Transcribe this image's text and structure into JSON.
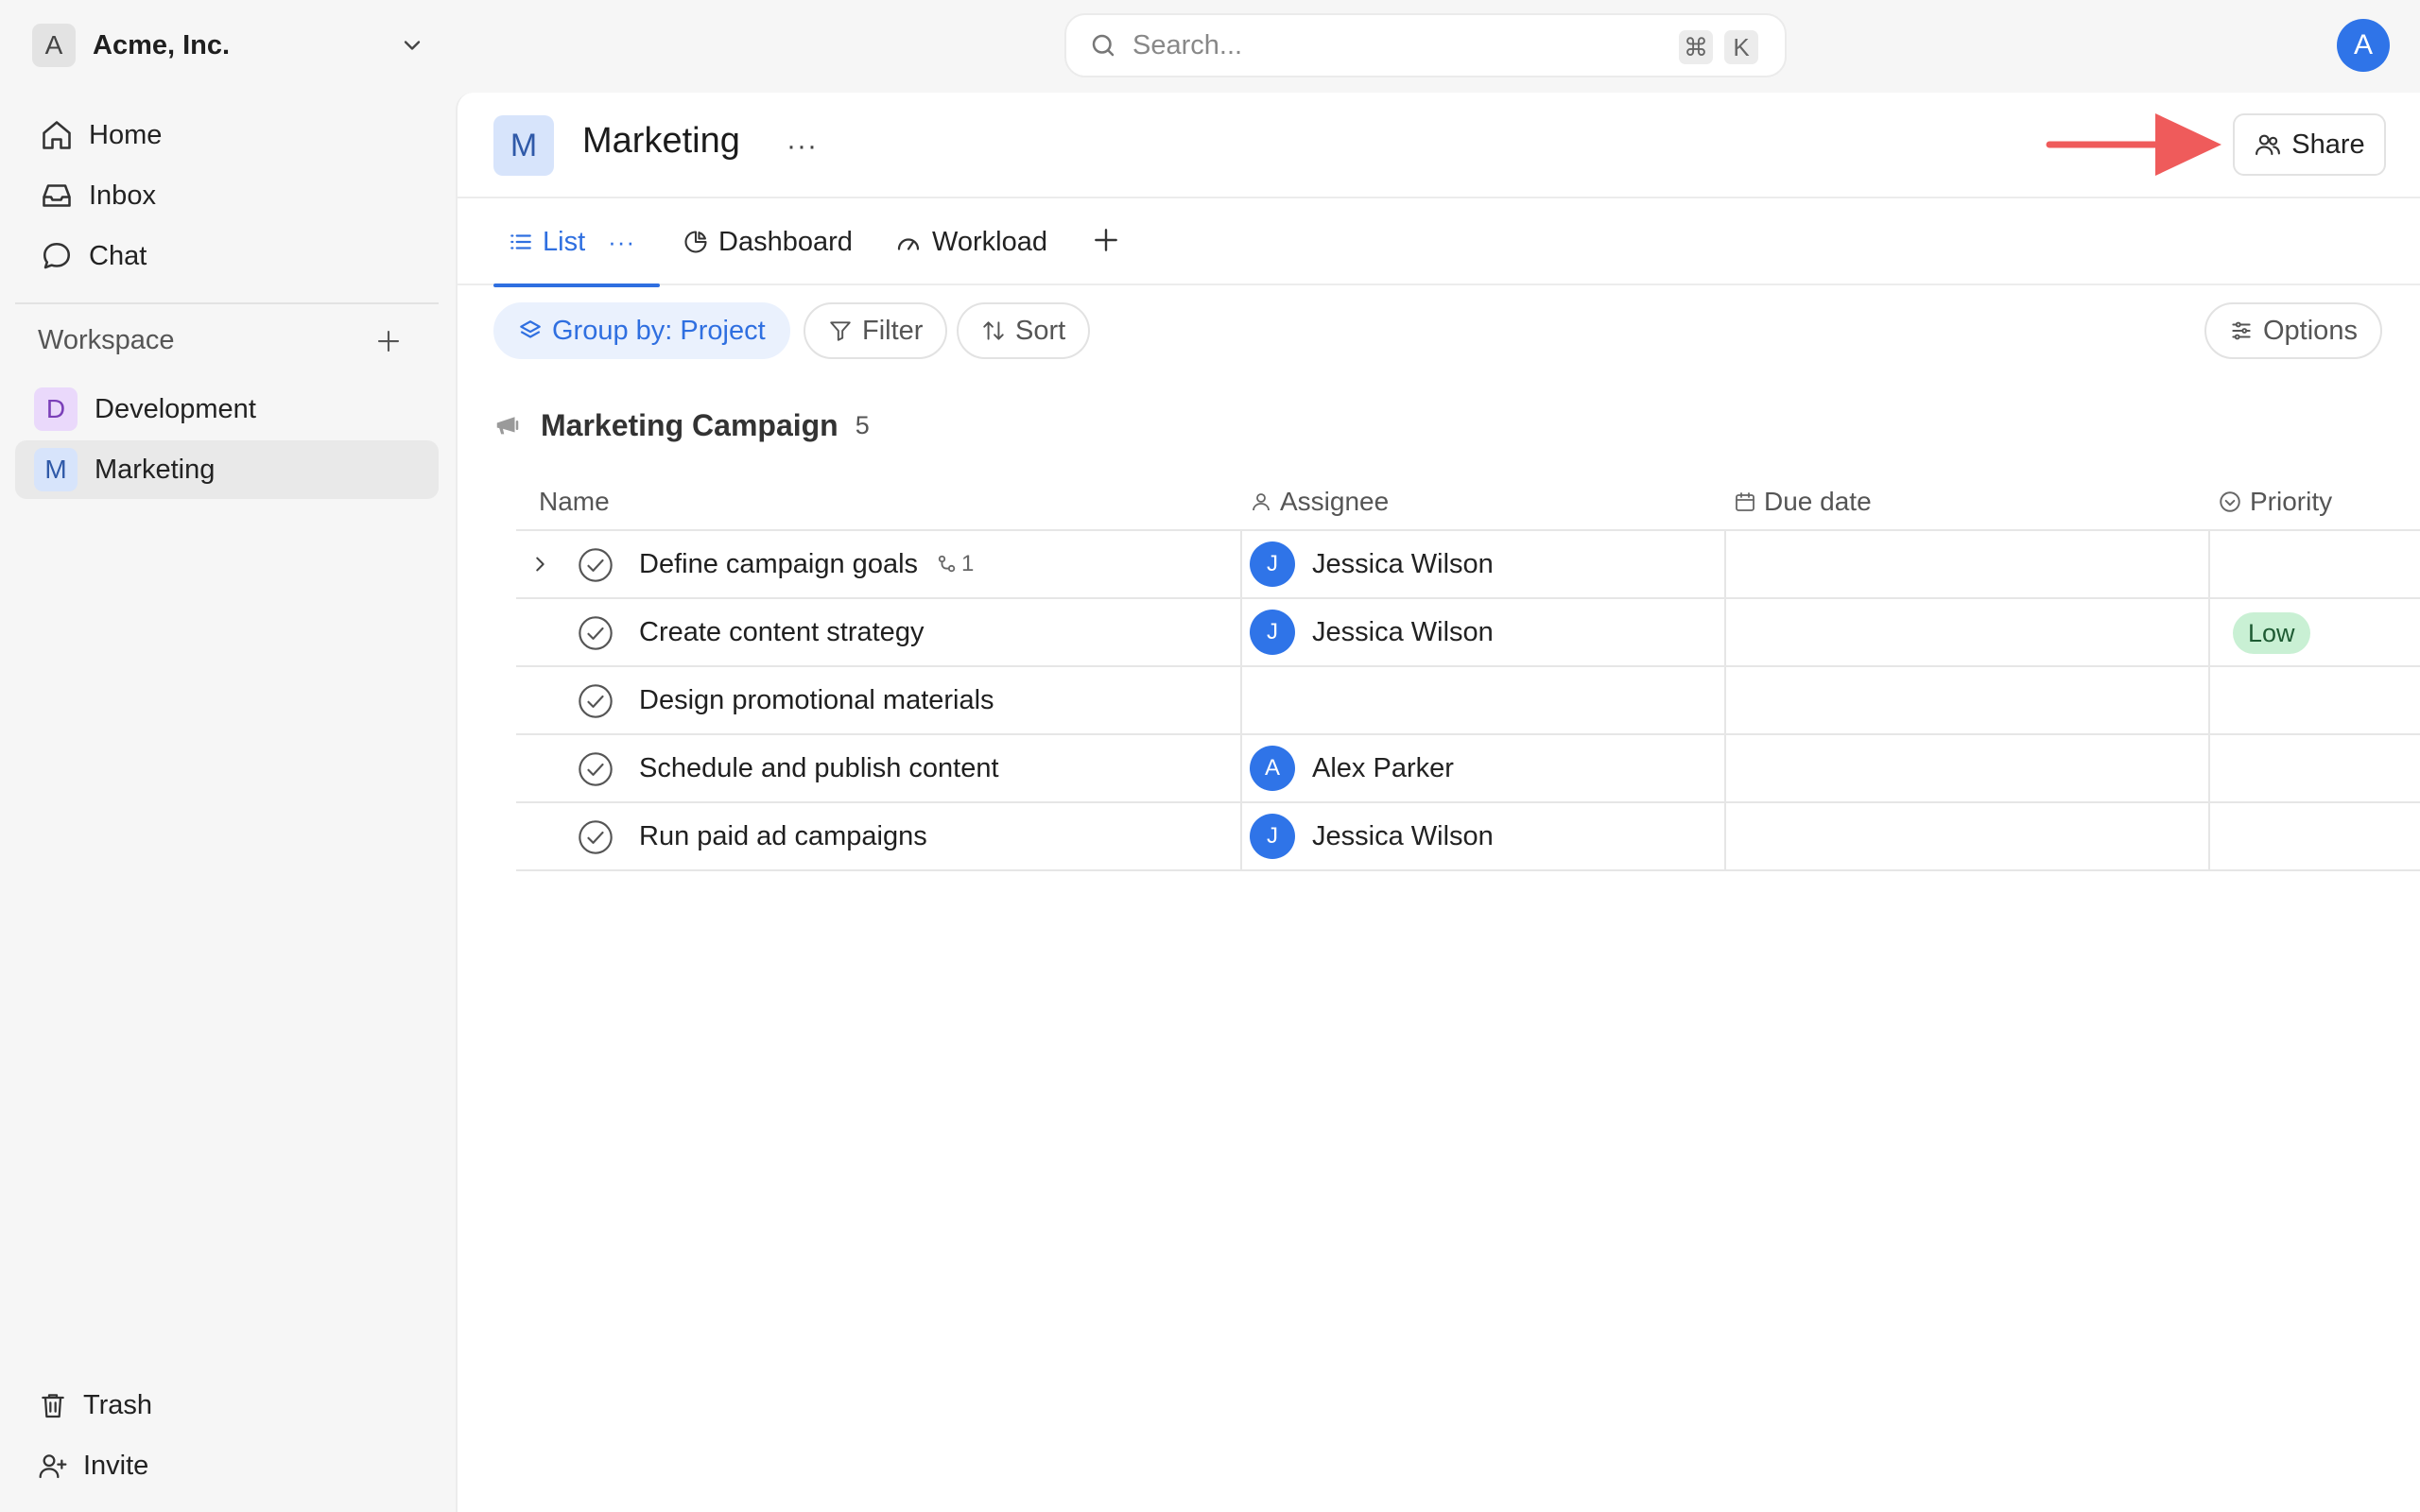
{
  "workspace_switcher": {
    "initial": "A",
    "name": "Acme, Inc."
  },
  "search": {
    "placeholder": "Search...",
    "shortcut_mod": "⌘",
    "shortcut_key": "K"
  },
  "user": {
    "initial": "A"
  },
  "sidebar": {
    "nav": [
      {
        "label": "Home",
        "icon": "home-icon"
      },
      {
        "label": "Inbox",
        "icon": "inbox-icon"
      },
      {
        "label": "Chat",
        "icon": "chat-icon"
      }
    ],
    "workspace_label": "Workspace",
    "projects": [
      {
        "initial": "D",
        "label": "Development",
        "color": "#ead9fb"
      },
      {
        "initial": "M",
        "label": "Marketing",
        "color": "#d7e4fb",
        "active": true
      }
    ],
    "bottom": [
      {
        "label": "Trash",
        "icon": "trash-icon"
      },
      {
        "label": "Invite",
        "icon": "invite-icon"
      }
    ]
  },
  "project": {
    "initial": "M",
    "title": "Marketing",
    "more": "···",
    "share_label": "Share"
  },
  "tabs": [
    {
      "label": "List",
      "active": true,
      "more": "···"
    },
    {
      "label": "Dashboard"
    },
    {
      "label": "Workload"
    }
  ],
  "toolbar": {
    "group_by": "Group by: Project",
    "filter": "Filter",
    "sort": "Sort",
    "options": "Options"
  },
  "group": {
    "title": "Marketing Campaign",
    "count": "5"
  },
  "table": {
    "columns": {
      "name": "Name",
      "assignee": "Assignee",
      "due_date": "Due date",
      "priority": "Priority"
    },
    "rows": [
      {
        "name": "Define campaign goals",
        "subtasks": "1",
        "assignee_initial": "J",
        "assignee": "Jessica Wilson",
        "due": "",
        "priority": ""
      },
      {
        "name": "Create content strategy",
        "assignee_initial": "J",
        "assignee": "Jessica Wilson",
        "due": "",
        "priority": "Low"
      },
      {
        "name": "Design promotional materials",
        "assignee_initial": "",
        "assignee": "",
        "due": "",
        "priority": ""
      },
      {
        "name": "Schedule and publish content",
        "assignee_initial": "A",
        "assignee": "Alex Parker",
        "due": "",
        "priority": ""
      },
      {
        "name": "Run paid ad campaigns",
        "assignee_initial": "J",
        "assignee": "Jessica Wilson",
        "due": "",
        "priority": ""
      }
    ]
  },
  "colors": {
    "accent": "#2f6fe0",
    "avatar_blue": "#2f74e8",
    "low_priority": "#c9f0d4",
    "annotation_arrow": "#ef5b5b"
  }
}
